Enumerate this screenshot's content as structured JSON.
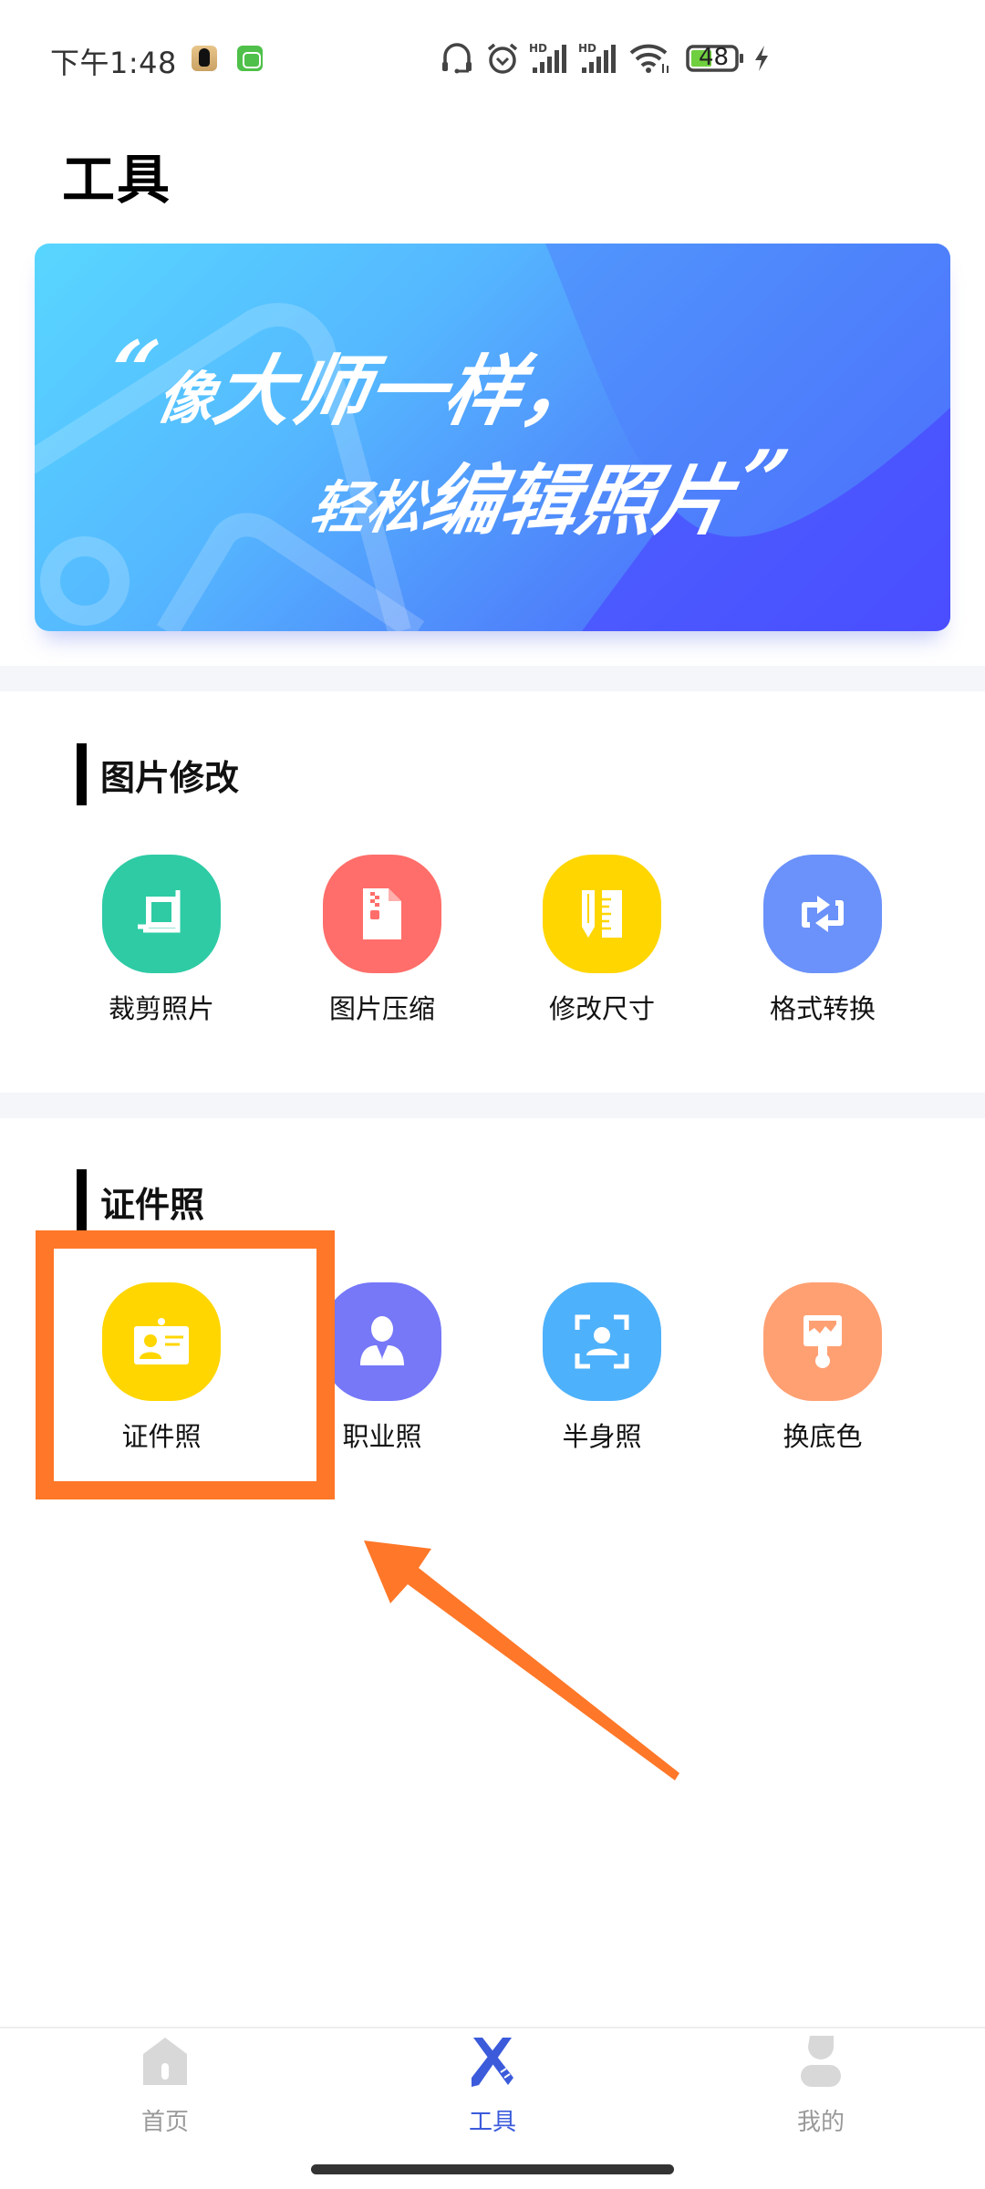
{
  "status_bar": {
    "time": "下午1:48",
    "battery_level": "48",
    "icons": [
      "app-badge-penguin",
      "app-badge-android",
      "headset-icon",
      "alarm-icon",
      "hd-signal-icon",
      "hd-signal-icon",
      "wifi-icon",
      "battery-icon",
      "charging-icon"
    ]
  },
  "header": {
    "title": "工具"
  },
  "banner": {
    "open_quote": "“",
    "line1_small": "像",
    "line1_large": "大师一样，",
    "line2_small": "轻松",
    "line2_large": "编辑照片",
    "close_quote": "”"
  },
  "sections": [
    {
      "title": "图片修改",
      "tools": [
        {
          "label": "裁剪照片",
          "icon": "crop-icon",
          "color": "#2ecba5"
        },
        {
          "label": "图片压缩",
          "icon": "zip-file-icon",
          "color": "#ff6e6a"
        },
        {
          "label": "修改尺寸",
          "icon": "pencil-ruler-icon",
          "color": "#ffd600"
        },
        {
          "label": "格式转换",
          "icon": "convert-arrows-icon",
          "color": "#6b92fa"
        }
      ]
    },
    {
      "title": "证件照",
      "tools": [
        {
          "label": "证件照",
          "icon": "id-card-icon",
          "color": "#ffd600"
        },
        {
          "label": "职业照",
          "icon": "business-person-icon",
          "color": "#7678f8"
        },
        {
          "label": "半身照",
          "icon": "portrait-scan-icon",
          "color": "#4eb1fb"
        },
        {
          "label": "换底色",
          "icon": "paint-brush-icon",
          "color": "#ffa073"
        }
      ]
    }
  ],
  "annotation": {
    "color": "#ff7728",
    "target": "证件照"
  },
  "bottom_nav": {
    "items": [
      {
        "label": "首页",
        "icon": "home-icon",
        "active": false
      },
      {
        "label": "工具",
        "icon": "tools-icon",
        "active": true
      },
      {
        "label": "我的",
        "icon": "profile-icon",
        "active": false
      }
    ],
    "active_color": "#3b5bdb",
    "inactive_color": "#999999"
  }
}
